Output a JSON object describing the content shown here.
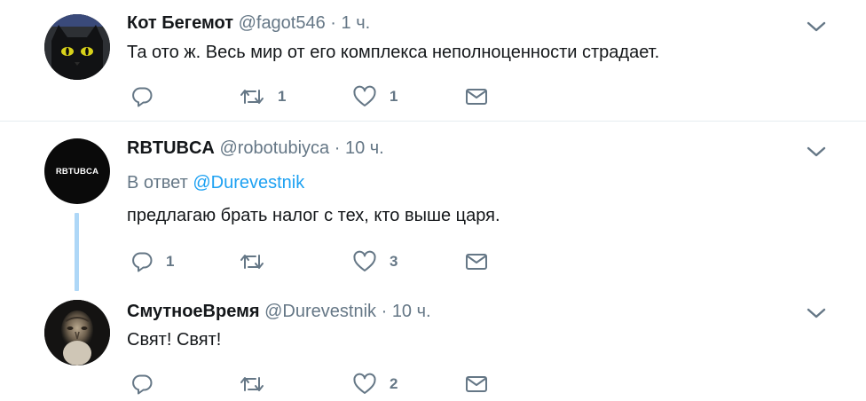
{
  "colors": {
    "accent": "#1da1f2",
    "secondary_text": "#657786",
    "thread_line": "#aed7f7",
    "divider": "#e6ecf0"
  },
  "tweets": [
    {
      "name": "Кот Бегемот",
      "handle": "@fagot546",
      "separator": "·",
      "time": "1 ч.",
      "text": "Та ото ж. Весь мир от его комплекса неполноценности страдает.",
      "reply_count": "",
      "retweet_count": "1",
      "like_count": "1",
      "avatar_icon": "black-cat-avatar"
    },
    {
      "name": "RBTUBCA",
      "handle": "@robotubiyca",
      "separator": "·",
      "time": "10 ч.",
      "reply_prefix": "В ответ",
      "reply_mention": "@Durevestnik",
      "text": "предлагаю брать налог с тех, кто выше царя.",
      "reply_count": "1",
      "retweet_count": "",
      "like_count": "3",
      "avatar_text": "RBTUBCA"
    },
    {
      "name": "СмутноеВремя",
      "handle": "@Durevestnik",
      "separator": "·",
      "time": "10 ч.",
      "text": "Свят! Свят!",
      "reply_count": "",
      "retweet_count": "",
      "like_count": "2",
      "avatar_icon": "bearded-man-portrait-avatar"
    }
  ]
}
